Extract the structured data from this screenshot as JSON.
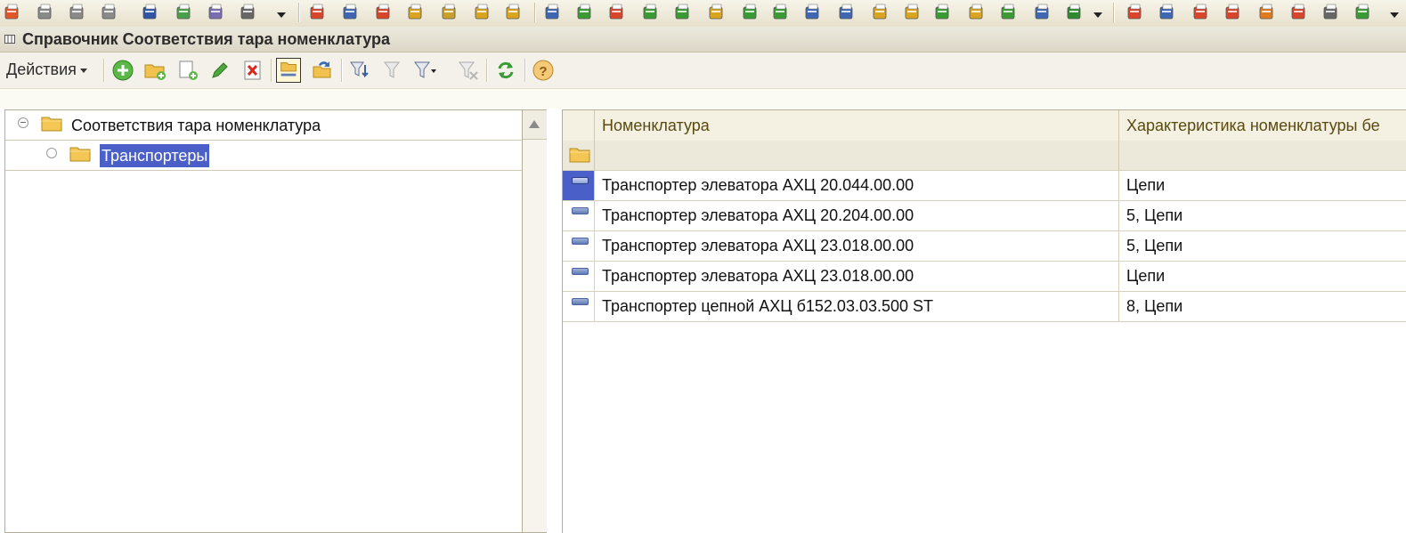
{
  "window": {
    "title": "Справочник Соответствия тара номенклатура"
  },
  "actions": {
    "menu_label": "Действия"
  },
  "tree": {
    "root_label": "Соответствия тара номенклатура",
    "child_label": "Транспортеры"
  },
  "grid": {
    "columns": [
      "Номенклатура",
      "Характеристика номенклатуры бе"
    ],
    "rows": [
      {
        "nomenclature": "Транспортер элеватора АХЦ 20.044.00.00",
        "characteristic": "Цепи"
      },
      {
        "nomenclature": "Транспортер элеватора АХЦ 20.204.00.00",
        "characteristic": "5, Цепи"
      },
      {
        "nomenclature": "Транспортер элеватора АХЦ 23.018.00.00",
        "characteristic": "5, Цепи"
      },
      {
        "nomenclature": "Транспортер элеватора АХЦ 23.018.00.00",
        "characteristic": "Цепи"
      },
      {
        "nomenclature": "Транспортер цепной АХЦ б152.03.03.500 ST",
        "characteristic": "8, Цепи"
      }
    ]
  },
  "colors": {
    "selection": "#4b5fc9",
    "header_text": "#5a4a10",
    "folder": "#f2c24e"
  }
}
